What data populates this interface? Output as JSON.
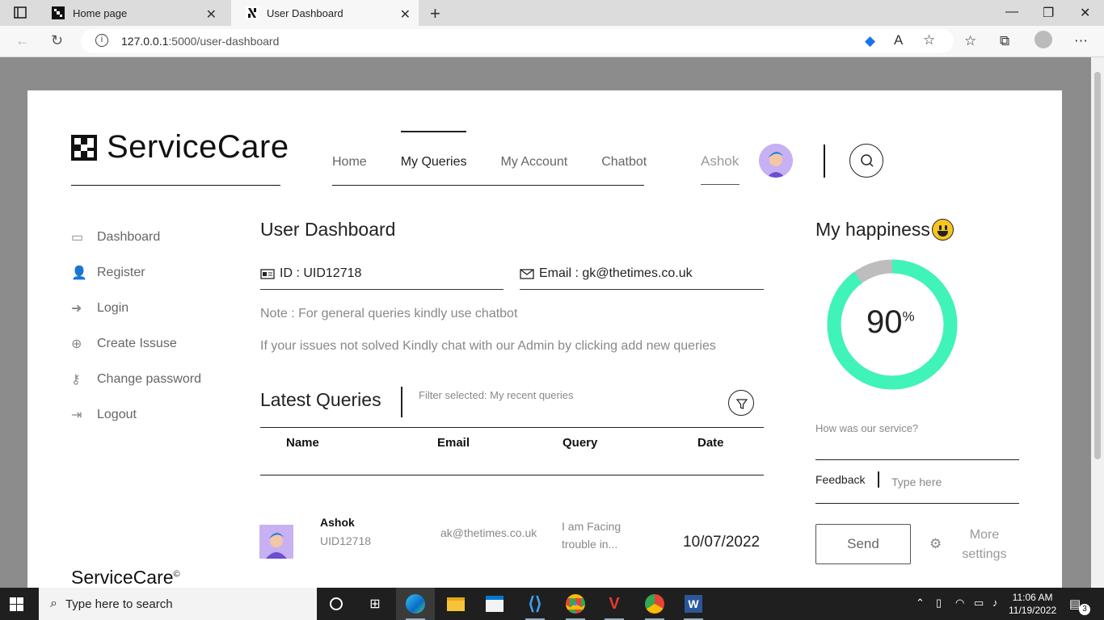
{
  "browser": {
    "tabs": [
      {
        "title": "Home page"
      },
      {
        "title": "User Dashboard"
      }
    ],
    "url_host": "127.0.0.1",
    "url_rest": ":5000/user-dashboard"
  },
  "header": {
    "brand": "ServiceCare",
    "nav": [
      "Home",
      "My Queries",
      "My Account",
      "Chatbot"
    ],
    "active_nav": "My Queries",
    "user_name": "Ashok"
  },
  "sidebar": {
    "items": [
      {
        "label": "Dashboard",
        "icon": "dashboard-icon"
      },
      {
        "label": "Register",
        "icon": "add-user-icon"
      },
      {
        "label": "Login",
        "icon": "login-icon"
      },
      {
        "label": "Create Issuse",
        "icon": "plus-circle-icon"
      },
      {
        "label": "Change password",
        "icon": "key-icon"
      },
      {
        "label": "Logout",
        "icon": "logout-icon"
      }
    ]
  },
  "main": {
    "title": "User Dashboard",
    "id_text": "ID : UID12718",
    "email_text": "Email : gk@thetimes.co.uk",
    "note1": "Note : For general queries kindly use chatbot",
    "note2": "If your issues not solved Kindly chat with our Admin by clicking add new queries",
    "latest_title": "Latest Queries",
    "filter_text": "Filter selected: My recent queries",
    "columns": [
      "Name",
      "Email",
      "Query",
      "Date"
    ],
    "rows": [
      {
        "name": "Ashok",
        "uid": "UID12718",
        "email": "ak@thetimes.co.uk",
        "query": "I am Facing trouble in...",
        "date": "10/07/2022"
      }
    ]
  },
  "footer": {
    "brand": "ServiceCare",
    "mark": "©"
  },
  "happiness": {
    "title": "My happiness",
    "value": 90,
    "unit": "%",
    "question": "How was our service?",
    "feedback_label": "Feedback",
    "feedback_placeholder": "Type here",
    "send_label": "Send",
    "more_settings": "More settings",
    "ring_color": "#3ff3b9",
    "ring_bg_color": "#bdbdbd"
  },
  "taskbar": {
    "search_placeholder": "Type here to search",
    "time": "11:06 AM",
    "date": "11/19/2022",
    "notifications": "3"
  }
}
